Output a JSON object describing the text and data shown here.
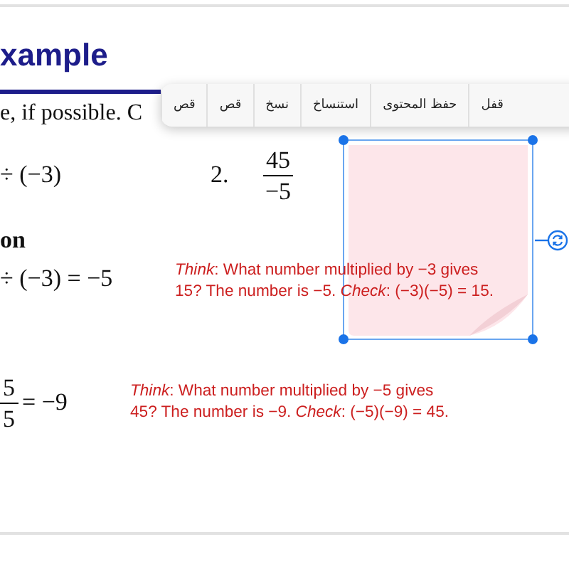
{
  "heading": "xample",
  "instruction": "e, if possible. C",
  "problem_1_partial": "÷ (−3)",
  "problem_2": {
    "number": "2.",
    "numerator": "45",
    "denominator": "−5"
  },
  "solution_heading": "on",
  "solution_1": {
    "equation": "÷ (−3) = −5",
    "explanation_lines": [
      "*Think*: What number multiplied by −3 gives",
      "15? The number is −5. *Check*: (−3)(−5) = 15."
    ]
  },
  "solution_2": {
    "numerator": "5",
    "denominator": "5",
    "result": "= −9",
    "explanation_lines": [
      "*Think*: What number multiplied by −5 gives",
      "45? The number is −9. *Check*: (−5)(−9) = 45."
    ]
  },
  "context_menu": {
    "items": [
      "قفل",
      "حفظ المحتوى",
      "استنساخ",
      "نسخ",
      "قص",
      "قص"
    ]
  },
  "sticky_note": {
    "selected": true
  }
}
